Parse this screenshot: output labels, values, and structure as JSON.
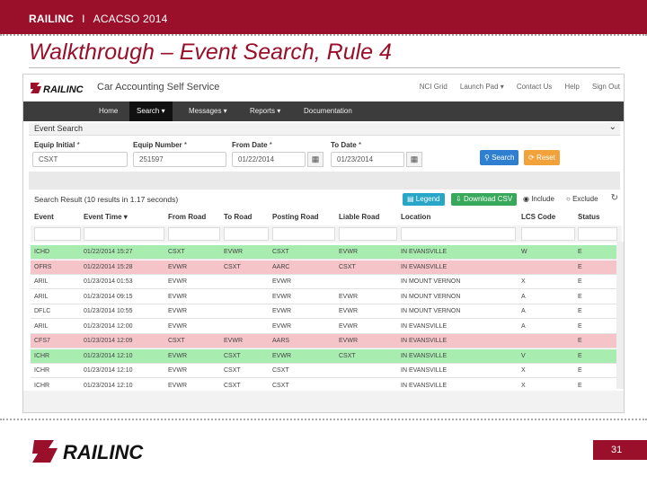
{
  "slide": {
    "brand": "RAILINC",
    "separator": "I",
    "event": "ACACSO 2014",
    "title": "Walkthrough – Event Search, Rule 4",
    "page_number": "31",
    "footer_logo_text": "RAILINC",
    "colors": {
      "primary": "#9a0f2a",
      "nav": "#3c3c3c",
      "green_row": "#a8ecb0",
      "red_row": "#f5c4c9"
    }
  },
  "app": {
    "logo_text": "RAILINC",
    "title": "Car Accounting Self Service",
    "top_links": [
      "NCI Grid",
      "Launch Pad ▾",
      "Contact Us",
      "Help",
      "Sign Out"
    ],
    "nav": [
      "Home",
      "Search ▾",
      "Messages ▾",
      "Reports ▾",
      "Documentation"
    ],
    "active_nav": "Search ▾",
    "panel_title": "Event Search",
    "fields": {
      "equip_initial": {
        "label": "Equip Initial",
        "required": "*",
        "value": "CSXT"
      },
      "equip_number": {
        "label": "Equip Number",
        "required": "*",
        "value": "251597"
      },
      "from_date": {
        "label": "From Date",
        "required": "*",
        "value": "01/22/2014"
      },
      "to_date": {
        "label": "To Date",
        "required": "*",
        "value": "01/23/2014"
      }
    },
    "buttons": {
      "search": "Search",
      "reset": "Reset",
      "legend": "Legend",
      "download": "Download CSV"
    },
    "result_summary": "Search Result (10 results in 1.17 seconds)",
    "radio": {
      "include": "Include",
      "exclude": "Exclude"
    },
    "columns": [
      "Event",
      "Event Time ▾",
      "From Road",
      "To Road",
      "Posting Road",
      "Liable Road",
      "Location",
      "LCS Code",
      "Status"
    ],
    "rows": [
      {
        "color": "green",
        "cells": [
          "ICHD",
          "01/22/2014 15:27",
          "CSXT",
          "EVWR",
          "CSXT",
          "EVWR",
          "IN EVANSVILLE",
          "W",
          "E"
        ]
      },
      {
        "color": "red",
        "cells": [
          "OFRS",
          "01/22/2014 15:28",
          "EVWR",
          "CSXT",
          "AARC",
          "CSXT",
          "IN EVANSVILLE",
          "",
          "E"
        ]
      },
      {
        "color": "",
        "cells": [
          "ARIL",
          "01/23/2014 01:53",
          "EVWR",
          "",
          "EVWR",
          "",
          "IN MOUNT VERNON",
          "X",
          "E"
        ]
      },
      {
        "color": "",
        "cells": [
          "ARIL",
          "01/23/2014 09:15",
          "EVWR",
          "",
          "EVWR",
          "EVWR",
          "IN MOUNT VERNON",
          "A",
          "E"
        ]
      },
      {
        "color": "",
        "cells": [
          "DFLC",
          "01/23/2014 10:55",
          "EVWR",
          "",
          "EVWR",
          "EVWR",
          "IN MOUNT VERNON",
          "A",
          "E"
        ]
      },
      {
        "color": "",
        "cells": [
          "ARIL",
          "01/23/2014 12:00",
          "EVWR",
          "",
          "EVWR",
          "EVWR",
          "IN EVANSVILLE",
          "A",
          "E"
        ]
      },
      {
        "color": "red",
        "cells": [
          "CFS7",
          "01/23/2014 12:09",
          "CSXT",
          "EVWR",
          "AARS",
          "EVWR",
          "IN EVANSVILLE",
          "",
          "E"
        ]
      },
      {
        "color": "green",
        "cells": [
          "ICHR",
          "01/23/2014 12:10",
          "EVWR",
          "CSXT",
          "EVWR",
          "CSXT",
          "IN EVANSVILLE",
          "V",
          "E"
        ]
      },
      {
        "color": "",
        "cells": [
          "ICHR",
          "01/23/2014 12:10",
          "EVWR",
          "CSXT",
          "CSXT",
          "",
          "IN EVANSVILLE",
          "X",
          "E"
        ]
      },
      {
        "color": "",
        "cells": [
          "ICHR",
          "01/23/2014 12:10",
          "EVWR",
          "CSXT",
          "CSXT",
          "",
          "IN EVANSVILLE",
          "X",
          "E"
        ]
      }
    ]
  }
}
